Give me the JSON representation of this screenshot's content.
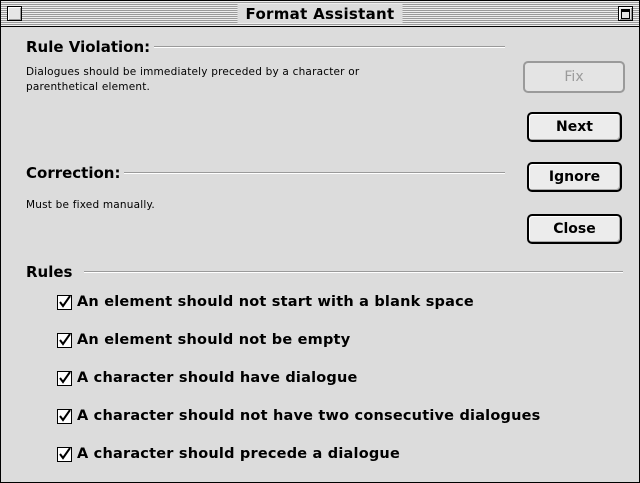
{
  "window": {
    "title": "Format Assistant"
  },
  "violation": {
    "heading": "Rule Violation:",
    "text_line1": "Dialogues should be immediately preceded by a character or",
    "text_line2": "parenthetical element."
  },
  "correction": {
    "heading": "Correction:",
    "text": "Must be fixed manually."
  },
  "buttons": {
    "fix": "Fix",
    "next": "Next",
    "ignore": "Ignore",
    "close": "Close"
  },
  "rules": {
    "heading": "Rules",
    "items": [
      {
        "label": "An element should not start with a blank space",
        "checked": true
      },
      {
        "label": "An element should not be empty",
        "checked": true
      },
      {
        "label": "A character should have dialogue",
        "checked": true
      },
      {
        "label": "A character should not have two consecutive dialogues",
        "checked": true
      },
      {
        "label": "A character should precede a dialogue",
        "checked": true
      }
    ]
  }
}
